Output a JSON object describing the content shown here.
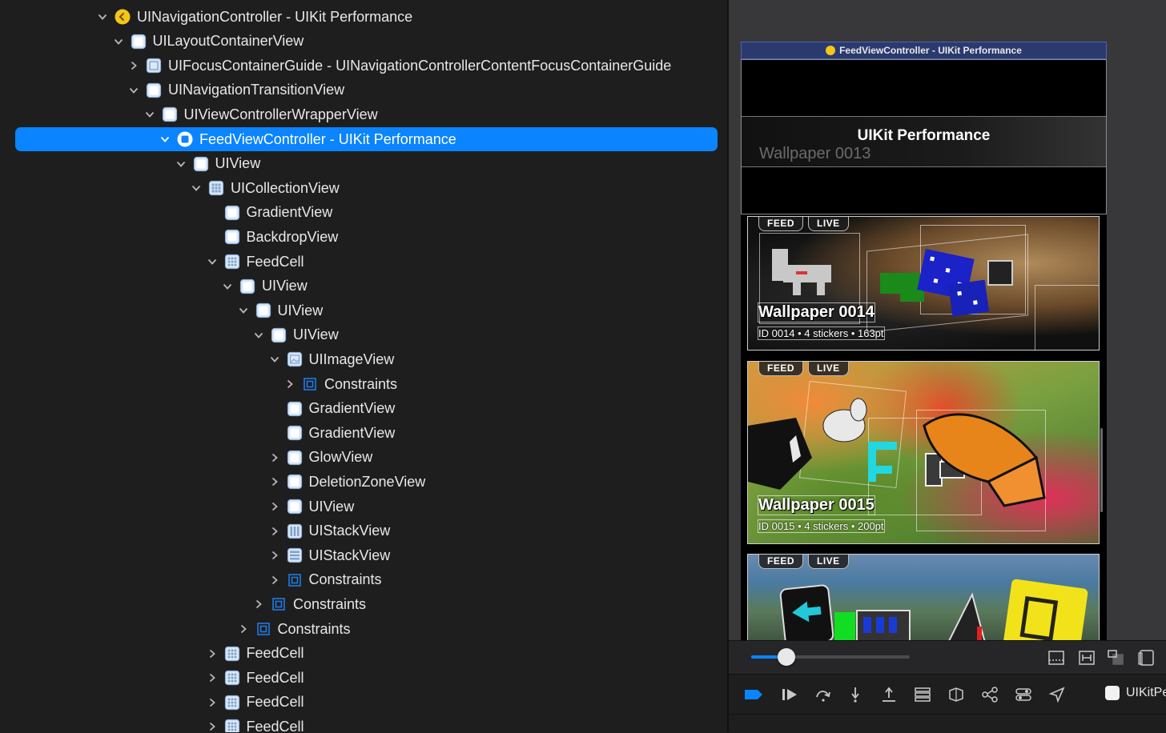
{
  "colors": {
    "selection": "#0a84ff",
    "view_icon": "#dbe8f7",
    "view_icon_border": "#8fb3da",
    "constraint_icon": "#1f7ae0",
    "navcontroller_icon": "#f5c518",
    "background": "#1e1e1f"
  },
  "tree": [
    {
      "label": "UINavigationController - UIKit Performance",
      "icon": "navigation-controller-icon",
      "level": 0,
      "expander": "expanded"
    },
    {
      "label": "UILayoutContainerView",
      "icon": "view-icon",
      "level": 1,
      "expander": "expanded"
    },
    {
      "label": "UIFocusContainerGuide - UINavigationControllerContentFocusContainerGuide",
      "icon": "focus-guide-icon",
      "level": 2,
      "expander": "collapsed"
    },
    {
      "label": "UINavigationTransitionView",
      "icon": "view-icon",
      "level": 2,
      "expander": "expanded"
    },
    {
      "label": "UIViewControllerWrapperView",
      "icon": "view-icon",
      "level": 3,
      "expander": "expanded"
    },
    {
      "label": "FeedViewController - UIKit Performance",
      "icon": "view-controller-icon",
      "level": 4,
      "expander": "expanded",
      "selected": true
    },
    {
      "label": "UIView",
      "icon": "view-icon",
      "level": 5,
      "expander": "expanded"
    },
    {
      "label": "UICollectionView",
      "icon": "collection-view-icon",
      "level": 6,
      "expander": "expanded"
    },
    {
      "label": "GradientView",
      "icon": "view-icon",
      "level": 7,
      "expander": "none"
    },
    {
      "label": "BackdropView",
      "icon": "view-icon",
      "level": 7,
      "expander": "none"
    },
    {
      "label": "FeedCell",
      "icon": "collection-cell-icon",
      "level": 7,
      "expander": "expanded"
    },
    {
      "label": "UIView",
      "icon": "view-icon",
      "level": 8,
      "expander": "expanded"
    },
    {
      "label": "UIView",
      "icon": "view-icon",
      "level": 9,
      "expander": "expanded"
    },
    {
      "label": "UIView",
      "icon": "view-icon",
      "level": 10,
      "expander": "expanded"
    },
    {
      "label": "UIImageView",
      "icon": "image-view-icon",
      "level": 11,
      "expander": "expanded"
    },
    {
      "label": "Constraints",
      "icon": "constraints-icon",
      "level": 12,
      "expander": "collapsed"
    },
    {
      "label": "GradientView",
      "icon": "view-icon",
      "level": 11,
      "expander": "none"
    },
    {
      "label": "GradientView",
      "icon": "view-icon",
      "level": 11,
      "expander": "none"
    },
    {
      "label": "GlowView",
      "icon": "view-icon",
      "level": 11,
      "expander": "collapsed"
    },
    {
      "label": "DeletionZoneView",
      "icon": "view-icon",
      "level": 11,
      "expander": "collapsed"
    },
    {
      "label": "UIView",
      "icon": "view-icon",
      "level": 11,
      "expander": "collapsed"
    },
    {
      "label": "UIStackView",
      "icon": "stack-view-horizontal-icon",
      "level": 11,
      "expander": "collapsed"
    },
    {
      "label": "UIStackView",
      "icon": "stack-view-vertical-icon",
      "level": 11,
      "expander": "collapsed"
    },
    {
      "label": "Constraints",
      "icon": "constraints-icon",
      "level": 11,
      "expander": "collapsed"
    },
    {
      "label": "Constraints",
      "icon": "constraints-icon",
      "level": 10,
      "expander": "collapsed"
    },
    {
      "label": "Constraints",
      "icon": "constraints-icon",
      "level": 9,
      "expander": "collapsed"
    },
    {
      "label": "FeedCell",
      "icon": "collection-cell-icon",
      "level": 7,
      "expander": "collapsed"
    },
    {
      "label": "FeedCell",
      "icon": "collection-cell-icon",
      "level": 7,
      "expander": "collapsed"
    },
    {
      "label": "FeedCell",
      "icon": "collection-cell-icon",
      "level": 7,
      "expander": "collapsed"
    },
    {
      "label": "FeedCell",
      "icon": "collection-cell-icon",
      "level": 7,
      "expander": "collapsed"
    }
  ],
  "canvas": {
    "frame_title": "FeedViewController - UIKit Performance",
    "nav_title": "UIKit Performance",
    "nav_ghost_text": "Wallpaper 0013",
    "cards": [
      {
        "feed_label": "FEED",
        "live_label": "LIVE",
        "title": "Wallpaper 0014",
        "meta": "ID 0014 • 4 stickers • 163pt"
      },
      {
        "feed_label": "FEED",
        "live_label": "LIVE",
        "title": "Wallpaper 0015",
        "meta": "ID 0015 • 4 stickers • 200pt"
      },
      {
        "feed_label": "FEED",
        "live_label": "LIVE",
        "title": "",
        "meta": ""
      }
    ]
  },
  "zoom": {
    "level": 0.22
  },
  "debug_bar": {
    "app_label": "UIKitPerfo",
    "buttons": [
      "breakpoints-toggle-icon",
      "continue-icon",
      "step-over-icon",
      "step-into-icon",
      "step-out-icon",
      "debug-view-hierarchy-icon",
      "memory-graph-icon",
      "environment-overrides-icon",
      "simulate-location-icon",
      "location-arrow-icon"
    ]
  },
  "zoom_buttons": [
    "fit-height-icon",
    "fit-width-icon",
    "show-clipped-icon",
    "orientation-icon"
  ]
}
